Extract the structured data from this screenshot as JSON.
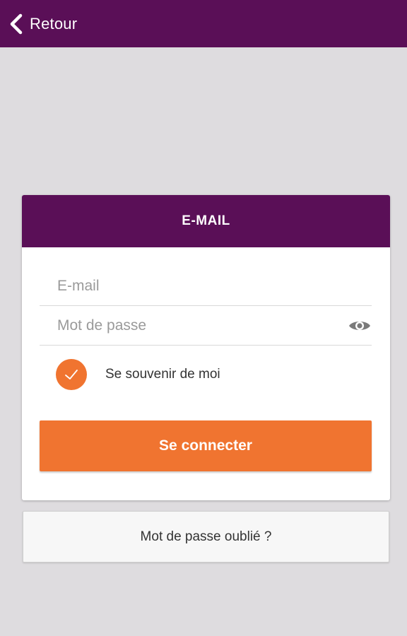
{
  "header": {
    "back_label": "Retour",
    "back_icon": "chevron-left-icon"
  },
  "login_card": {
    "title": "E-MAIL",
    "email": {
      "placeholder": "E-mail",
      "value": ""
    },
    "password": {
      "placeholder": "Mot de passe",
      "value": "",
      "toggle_icon": "eye-icon"
    },
    "remember": {
      "label": "Se souvenir de moi",
      "checked": true,
      "icon": "check-icon"
    },
    "submit_label": "Se connecter"
  },
  "forgot_password_label": "Mot de passe oublié ?",
  "colors": {
    "brand_purple": "#5a0f57",
    "accent_orange": "#f07430",
    "background": "#dedcdf",
    "card_background": "#ffffff"
  }
}
